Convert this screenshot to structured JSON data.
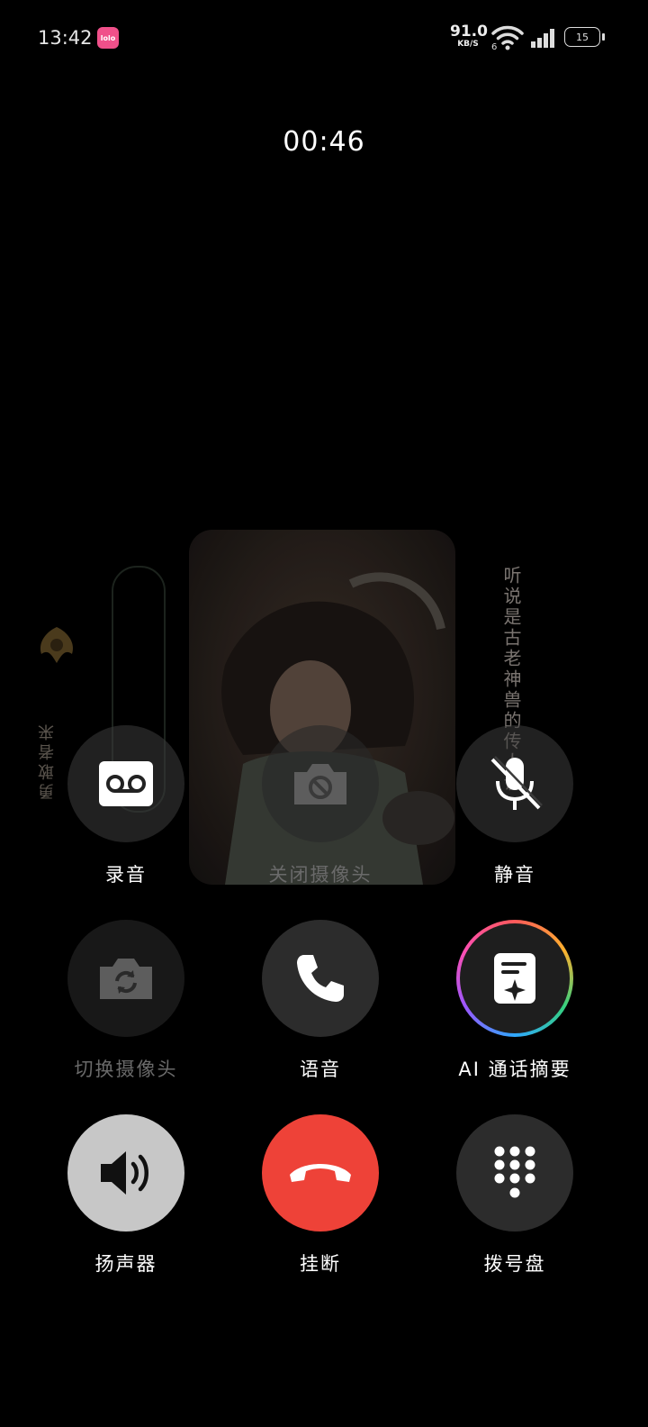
{
  "status_bar": {
    "time": "13:42",
    "app_badge_text": "lolo",
    "net_speed_value": "91.0",
    "net_speed_unit": "KB/S",
    "wifi_badge": "6",
    "battery_level": "15"
  },
  "call": {
    "duration": "00:46"
  },
  "background": {
    "left_text": "勇敢者来",
    "right_text": "听说是古老神兽的传人诶"
  },
  "controls": {
    "record": {
      "label": "录音",
      "icon": "record-icon"
    },
    "camera_off": {
      "label": "关闭摄像头",
      "icon": "camera-off-icon",
      "disabled": true
    },
    "mute": {
      "label": "静音",
      "icon": "mic-muted-icon"
    },
    "switch_camera": {
      "label": "切换摄像头",
      "icon": "switch-camera-icon",
      "disabled": true
    },
    "voice": {
      "label": "语音",
      "icon": "phone-icon"
    },
    "ai_summary": {
      "label": "AI 通话摘要",
      "icon": "ai-summary-icon"
    },
    "speaker": {
      "label": "扬声器",
      "icon": "speaker-icon"
    },
    "hangup": {
      "label": "挂断",
      "icon": "hangup-icon"
    },
    "dialpad": {
      "label": "拨号盘",
      "icon": "dialpad-icon"
    }
  },
  "colors": {
    "background": "#000000",
    "hangup": "#ee4238",
    "speaker_active": "#c7c7c7",
    "button_gray": "#2c2c2c"
  }
}
